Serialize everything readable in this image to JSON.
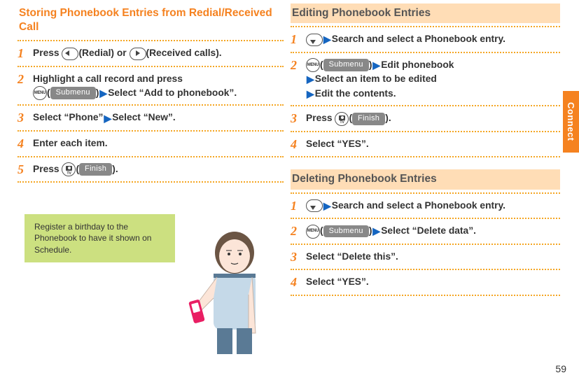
{
  "left": {
    "title": "Storing Phonebook Entries from Redial/Received Call",
    "steps": {
      "s1": {
        "num": "1",
        "pre": "Press ",
        "btn1_label": "(Redial)",
        "mid": " or ",
        "btn2_label": "(Received calls)."
      },
      "s2": {
        "num": "2",
        "pre": "Highlight a call record and press ",
        "menu_label": "MENU",
        "pill": "Submenu",
        "tail": "Select “Add to phonebook”."
      },
      "s3": {
        "num": "3",
        "a": "Select “Phone”",
        "b": "Select “New”."
      },
      "s4": {
        "num": "4",
        "text": "Enter each item."
      },
      "s5": {
        "num": "5",
        "pre": "Press ",
        "tv_label": "TV",
        "pill": "Finish",
        "tail": "."
      }
    },
    "callout": "Register a birthday to the Phonebook to have it shown on Schedule."
  },
  "right": {
    "edit": {
      "title": "Editing Phonebook Entries",
      "s1": {
        "num": "1",
        "text": "Search and select a Phonebook entry."
      },
      "s2": {
        "num": "2",
        "menu_label": "MENU",
        "pill": "Submenu",
        "a": "Edit phonebook",
        "b": "Select an item to be edited",
        "c": "Edit the contents."
      },
      "s3": {
        "num": "3",
        "pre": "Press ",
        "tv_label": "TV",
        "pill": "Finish",
        "tail": "."
      },
      "s4": {
        "num": "4",
        "text": "Select “YES”."
      }
    },
    "del": {
      "title": "Deleting Phonebook Entries",
      "s1": {
        "num": "1",
        "text": "Search and select a Phonebook entry."
      },
      "s2": {
        "num": "2",
        "menu_label": "MENU",
        "pill": "Submenu",
        "tail": "Select “Delete data”."
      },
      "s3": {
        "num": "3",
        "text": "Select “Delete this”."
      },
      "s4": {
        "num": "4",
        "text": "Select “YES”."
      }
    }
  },
  "side_tab": "Connect",
  "page_num": "59",
  "colors": {
    "orange": "#f58220",
    "green": "#cce080",
    "blue": "#1565c0"
  }
}
